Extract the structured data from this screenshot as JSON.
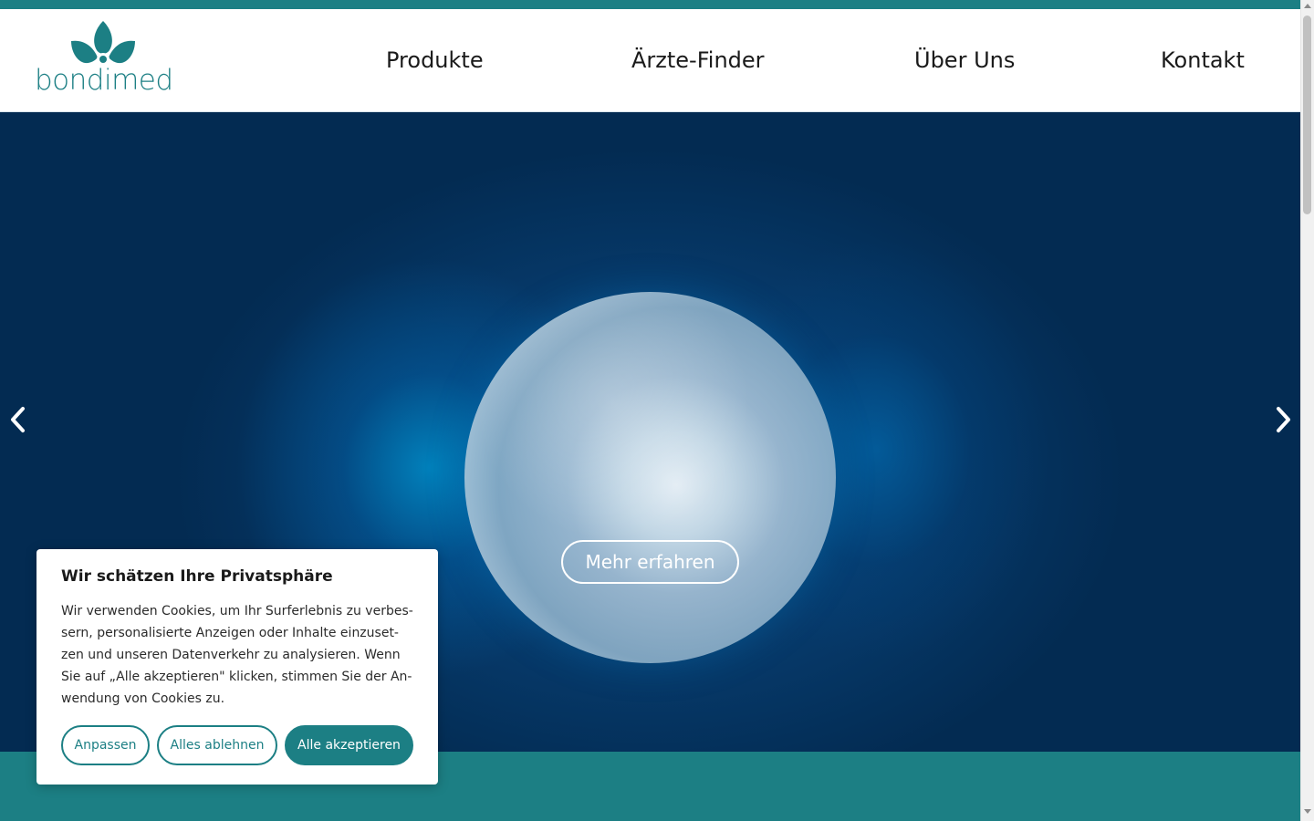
{
  "brand": {
    "name": "bondimed",
    "color": "#1c7f84"
  },
  "nav": {
    "items": [
      {
        "label": "Produkte"
      },
      {
        "label": "Ärzte-Finder"
      },
      {
        "label": "Über Uns"
      },
      {
        "label": "Kontakt"
      }
    ]
  },
  "hero": {
    "cta_label": "Mehr erfahren",
    "prev_icon": "chevron-left-icon",
    "next_icon": "chevron-right-icon"
  },
  "cookie": {
    "title": "Wir schätzen Ihre Privatsphäre",
    "text_lines": [
      "Wir verwenden Cookies, um Ihr Surferlebnis zu verbes-",
      "sern, personalisierte Anzeigen oder Inhalte einzuset-",
      "zen und unseren Datenverkehr zu analysieren. Wenn",
      "Sie auf „Alle akzeptieren\" klicken, stimmen Sie der An-",
      "wendung von Cookies zu."
    ],
    "buttons": {
      "customize": "Anpassen",
      "reject": "Alles ablehnen",
      "accept": "Alle akzeptieren"
    }
  },
  "colors": {
    "teal": "#1c7f84",
    "hero_dark": "#032b52",
    "hero_glow": "#0080c0"
  }
}
